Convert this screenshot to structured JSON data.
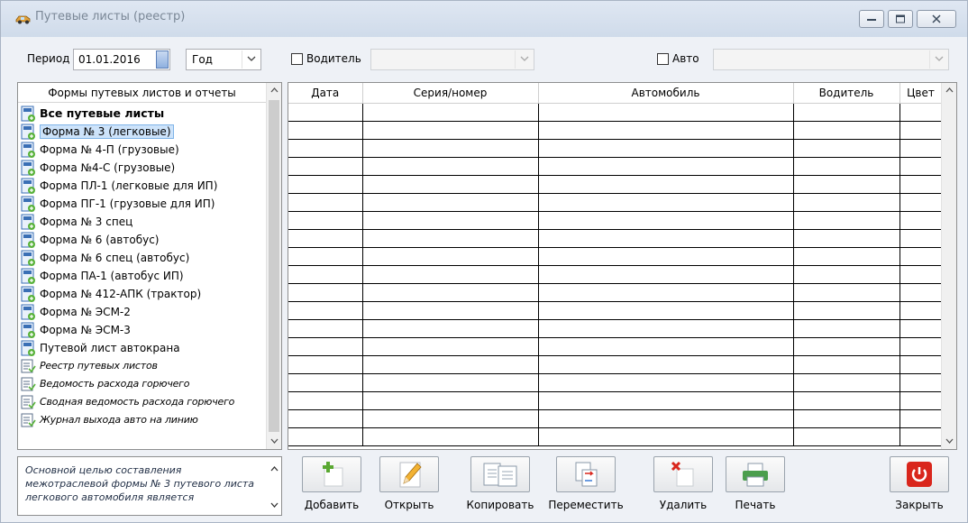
{
  "window": {
    "title": "Путевые листы (реестр)"
  },
  "filters": {
    "period_label": "Период",
    "period_date": "01.01.2016",
    "period_unit": "Год",
    "driver_label": "Водитель",
    "driver_value": "",
    "auto_label": "Авто",
    "auto_value": ""
  },
  "left_panel": {
    "header": "Формы путевых листов и отчеты",
    "items": [
      {
        "label": "Все путевые листы",
        "style": "bold",
        "icon": "form-icon"
      },
      {
        "label": "Форма № 3 (легковые)",
        "style": "selected",
        "icon": "form-icon"
      },
      {
        "label": "Форма № 4-П (грузовые)",
        "style": "normal",
        "icon": "form-icon"
      },
      {
        "label": "Форма №4-С (грузовые)",
        "style": "normal",
        "icon": "form-icon"
      },
      {
        "label": "Форма ПЛ-1 (легковые для ИП)",
        "style": "normal",
        "icon": "form-icon"
      },
      {
        "label": "Форма ПГ-1 (грузовые для ИП)",
        "style": "normal",
        "icon": "form-icon"
      },
      {
        "label": "Форма № 3 спец",
        "style": "normal",
        "icon": "form-icon"
      },
      {
        "label": "Форма № 6 (автобус)",
        "style": "normal",
        "icon": "form-icon"
      },
      {
        "label": "Форма № 6 спец (автобус)",
        "style": "normal",
        "icon": "form-icon"
      },
      {
        "label": "Форма ПА-1 (автобус ИП)",
        "style": "normal",
        "icon": "form-icon"
      },
      {
        "label": "Форма № 412-АПК (трактор)",
        "style": "normal",
        "icon": "form-icon"
      },
      {
        "label": "Форма № ЭСМ-2",
        "style": "normal",
        "icon": "form-icon"
      },
      {
        "label": "Форма № ЭСМ-3",
        "style": "normal",
        "icon": "form-icon"
      },
      {
        "label": "Путевой лист автокрана",
        "style": "normal",
        "icon": "form-icon"
      },
      {
        "label": "Реестр путевых листов",
        "style": "italic",
        "icon": "report-icon"
      },
      {
        "label": "Ведомость расхода горючего",
        "style": "italic",
        "icon": "report-icon"
      },
      {
        "label": "Сводная ведомость расхода горючего",
        "style": "italic",
        "icon": "report-icon"
      },
      {
        "label": "Журнал выхода авто на линию",
        "style": "italic",
        "icon": "report-icon"
      }
    ]
  },
  "grid": {
    "columns": [
      "Дата",
      "Серия/номер",
      "Автомобиль",
      "Водитель",
      "Цвет"
    ],
    "rows": []
  },
  "description": "Основной целью составления межотраслевой формы № 3 путевого листа легкового автомобиля является",
  "buttons": {
    "add": "Добавить",
    "open": "Открыть",
    "copy": "Копировать",
    "move": "Переместить",
    "delete": "Удалить",
    "print": "Печать",
    "close": "Закрыть"
  },
  "colors": {
    "selection": "#cde3fa",
    "close_red": "#d9261c",
    "add_green": "#5aa832"
  }
}
